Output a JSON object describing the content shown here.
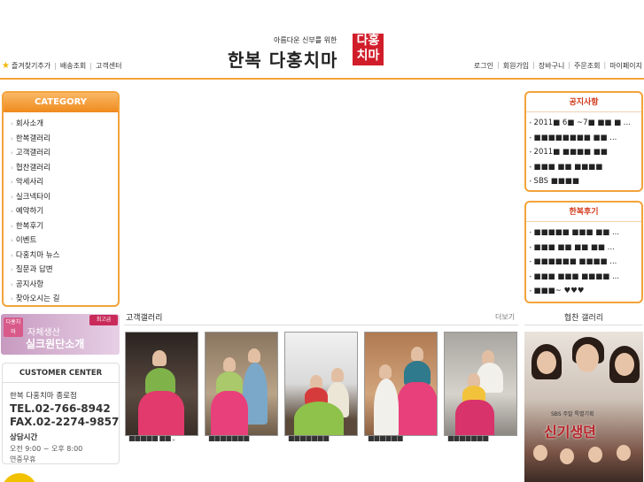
{
  "header": {
    "favorites": "즐겨찾기추가",
    "delivery": "배송조회",
    "customer_center": "고객센터",
    "logo_tagline": "아름다운 신부를 위한",
    "logo_main": "한복 다홍치마",
    "logo_box_top": "다홍",
    "logo_box_bottom": "치마",
    "links": [
      "로그인",
      "회원가입",
      "장바구니",
      "주문조회",
      "마이페이지"
    ]
  },
  "category": {
    "title": "CATEGORY",
    "items": [
      "회사소개",
      "한복갤러리",
      "고객갤러리",
      "협찬갤러리",
      "악세사리",
      "실크넥타이",
      "예약하기",
      "한복후기",
      "이벤트",
      "다홍치마 뉴스",
      "질문과 답변",
      "공지사항",
      "찾아오시는 길"
    ]
  },
  "silk_banner": {
    "badge_left": "다홍치마",
    "badge_right": "최고급",
    "line1": "자체생산",
    "line2": "실크원단소개"
  },
  "customer_center": {
    "title": "CUSTOMER CENTER",
    "store": "한복 다홍치마 종로점",
    "tel": "TEL.02-766-8942",
    "fax": "FAX.02-2274-9857",
    "hours_title": "상담시간",
    "hours": "오전 9:00 ~ 오후 8:00",
    "holiday": "연중무휴"
  },
  "gallery": {
    "title": "고객갤러리",
    "more": "더보기",
    "captions": [
      "■■■■■ ■■ ..",
      "■■■■■■■",
      "■■■■■■■",
      "■■■■■■",
      "■■■■■■■"
    ]
  },
  "notice": {
    "title": "공지사항",
    "items": [
      "2011■ 6■ ~7■ ■■ ■ ...",
      "■■■■■■■■ ■■ ...",
      "2011■ ■■■■ ■■",
      "■■■ ■■ ■■■■",
      "SBS ■■■■"
    ]
  },
  "reviews": {
    "title": "한복후기",
    "items": [
      "■■■■■ ■■■ ■■ ...",
      "■■■ ■■ ■■ ■■ ...",
      "■■■■■■ ■■■■ ...",
      "■■■ ■■■ ■■■■ ...",
      "■■■~ ♥♥♥"
    ]
  },
  "sponsor": {
    "title": "협찬 갤러리",
    "poster_title": "신기생뎐",
    "poster_sub": "SBS 주말 특별기획"
  },
  "colors": {
    "accent": "#f3a33a",
    "logo_red": "#d11d2a",
    "heading_red": "#d2391a"
  }
}
